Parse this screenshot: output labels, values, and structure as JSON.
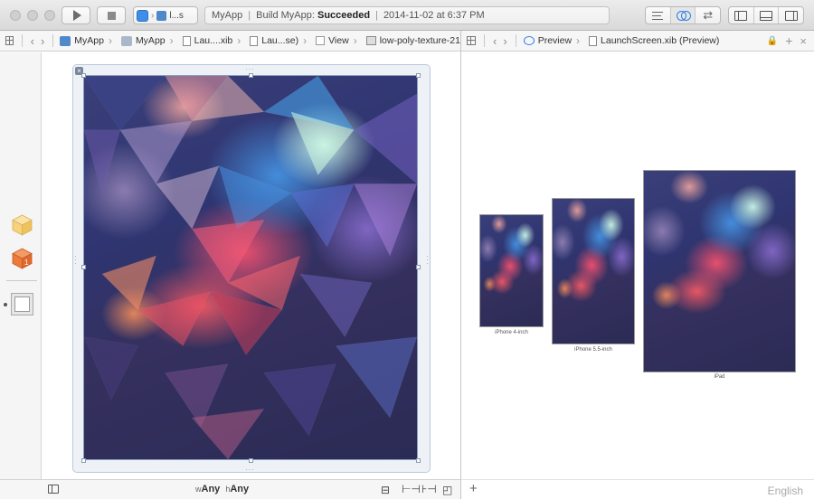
{
  "toolbar": {
    "scheme_label": "l...s",
    "activity": {
      "project": "MyApp",
      "status_prefix": "Build MyApp:",
      "status": "Succeeded",
      "timestamp": "2014-11-02 at 6:37 PM"
    }
  },
  "editor_jumpbar": {
    "crumbs": [
      "MyApp",
      "MyApp",
      "Lau....xib",
      "Lau...se)",
      "View",
      "low-poly-texture-21"
    ]
  },
  "preview_jumpbar": {
    "crumbs": [
      "Preview",
      "LaunchScreen.xib (Preview)"
    ]
  },
  "size_class": {
    "w_prefix": "w",
    "w_value": "Any",
    "h_prefix": "h",
    "h_value": "Any"
  },
  "preview": {
    "devices": [
      {
        "label": "iPhone 4-inch"
      },
      {
        "label": "iPhone 5.5-inch"
      },
      {
        "label": "iPad"
      }
    ],
    "language": "English"
  },
  "dock": {
    "badge_number": "1"
  },
  "colors": {
    "accent": "#2b7de9",
    "object_cube": "#f4c96a",
    "first_responder_cube": "#e8793a"
  }
}
